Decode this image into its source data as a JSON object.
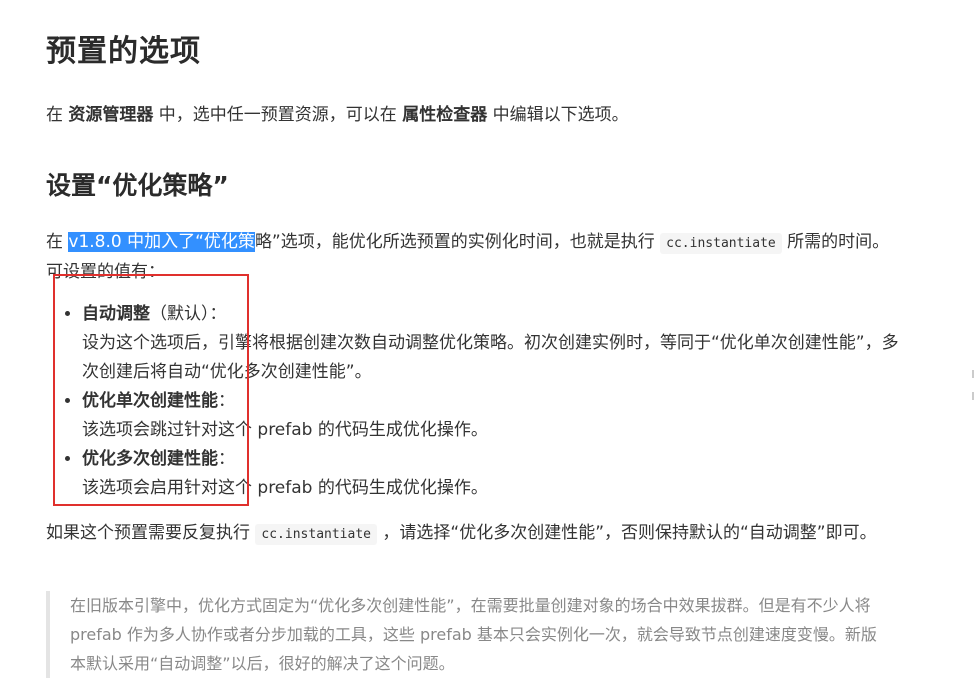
{
  "h1": "预置的选项",
  "p1": {
    "t1": "在 ",
    "b1": "资源管理器",
    "t2": " 中，选中任一预置资源，可以在 ",
    "b2": "属性检查器",
    "t3": " 中编辑以下选项。"
  },
  "h2": "设置“优化策略”",
  "p2": {
    "pre": "在 ",
    "hl": "v1.8.0 中加入了“优化策",
    "mid": "略”选项，能优化所选预置的实例化时间，也就是执行 ",
    "code": "cc.instantiate",
    "post": " 所需的时间。可设置的值有："
  },
  "list": [
    {
      "title": "自动调整",
      "paren": "（默认）：",
      "desc": "设为这个选项后，引擎将根据创建次数自动调整优化策略。初次创建实例时，等同于“优化单次创建性能”，多次创建后将自动“优化多次创建性能”。"
    },
    {
      "title": "优化单次创建性能",
      "paren": "：",
      "desc": "该选项会跳过针对这个 prefab 的代码生成优化操作。"
    },
    {
      "title": "优化多次创建性能",
      "paren": "：",
      "desc": "该选项会启用针对这个 prefab 的代码生成优化操作。"
    }
  ],
  "p3": {
    "pre": "如果这个预置需要反复执行 ",
    "code": "cc.instantiate",
    "post": " ，请选择“优化多次创建性能”，否则保持默认的“自动调整”即可。"
  },
  "quote": "在旧版本引擎中，优化方式固定为“优化多次创建性能”，在需要批量创建对象的场合中效果拔群。但是有不少人将 prefab 作为多人协作或者分步加载的工具，这些 prefab 基本只会实例化一次，就会导致节点创建速度变慢。新版本默认采用“自动调整”以后，很好的解决了这个问题。",
  "colors": {
    "highlight": "#3390ff",
    "annotation_box": "#e0302d"
  }
}
